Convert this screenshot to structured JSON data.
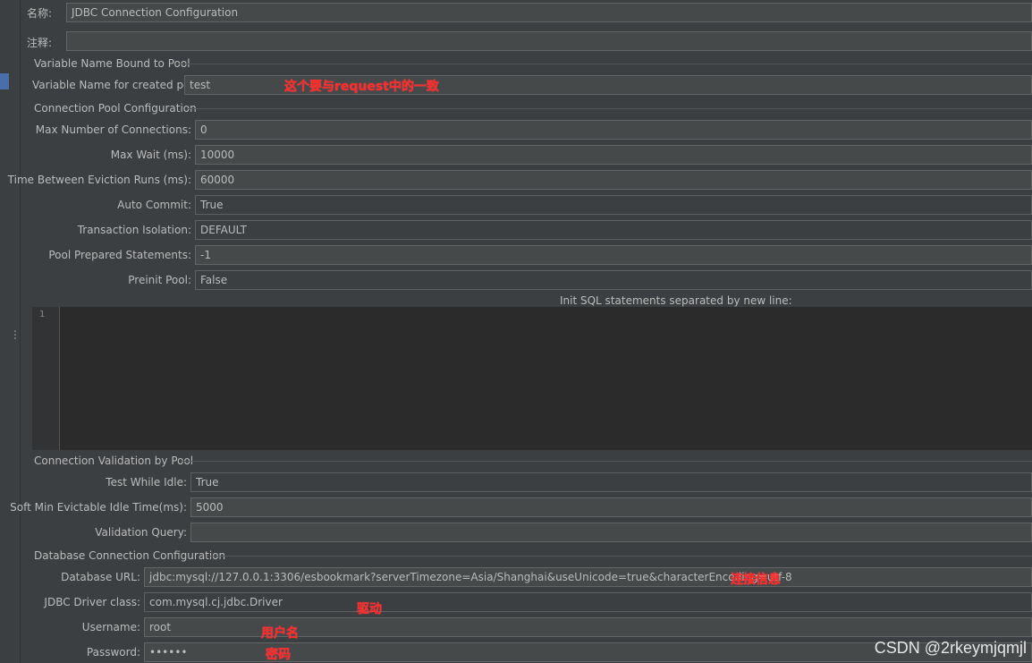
{
  "header": {
    "name_label": "名称:",
    "name_value": "JDBC Connection Configuration",
    "comment_label": "注释:",
    "comment_value": ""
  },
  "variable_section": {
    "title": "Variable Name Bound to Pool",
    "pool_var_label": "Variable Name for created pool:",
    "pool_var_value": "test"
  },
  "pool_section": {
    "title": "Connection Pool Configuration",
    "max_connections_label": "Max Number of Connections:",
    "max_connections_value": "0",
    "max_wait_label": "Max Wait (ms):",
    "max_wait_value": "10000",
    "eviction_label": "Time Between Eviction Runs (ms):",
    "eviction_value": "60000",
    "auto_commit_label": "Auto Commit:",
    "auto_commit_value": "True",
    "isolation_label": "Transaction Isolation:",
    "isolation_value": "DEFAULT",
    "prepared_label": "Pool Prepared Statements:",
    "prepared_value": "-1",
    "preinit_label": "Preinit Pool:",
    "preinit_value": "False",
    "init_sql_label": "Init SQL statements separated by new line:",
    "init_sql_line_number": "1"
  },
  "validation_section": {
    "title": "Connection Validation by Pool",
    "test_idle_label": "Test While Idle:",
    "test_idle_value": "True",
    "soft_min_label": "Soft Min Evictable Idle Time(ms):",
    "soft_min_value": "5000",
    "validation_query_label": "Validation Query:",
    "validation_query_value": ""
  },
  "db_section": {
    "title": "Database Connection Configuration",
    "url_label": "Database URL:",
    "url_value": "jdbc:mysql://127.0.0.1:3306/esbookmark?serverTimezone=Asia/Shanghai&useUnicode=true&characterEncoding=utf-8",
    "driver_label": "JDBC Driver class:",
    "driver_value": "com.mysql.cj.jdbc.Driver",
    "username_label": "Username:",
    "username_value": "root",
    "password_label": "Password:",
    "password_value": "••••••"
  },
  "annotations": {
    "pool_name_note": "这个要与request中的一致",
    "url_note": "连接信息",
    "driver_note": "驱动",
    "username_note": "用户名",
    "password_note": "密码"
  },
  "watermark": "CSDN @2rkeymjqmjl",
  "colors": {
    "background": "#3c3f41",
    "field_bg": "#45494a",
    "editor_bg": "#2b2b2b",
    "annotation": "#ff2a2a",
    "selection_marker": "#4a6ea9"
  }
}
